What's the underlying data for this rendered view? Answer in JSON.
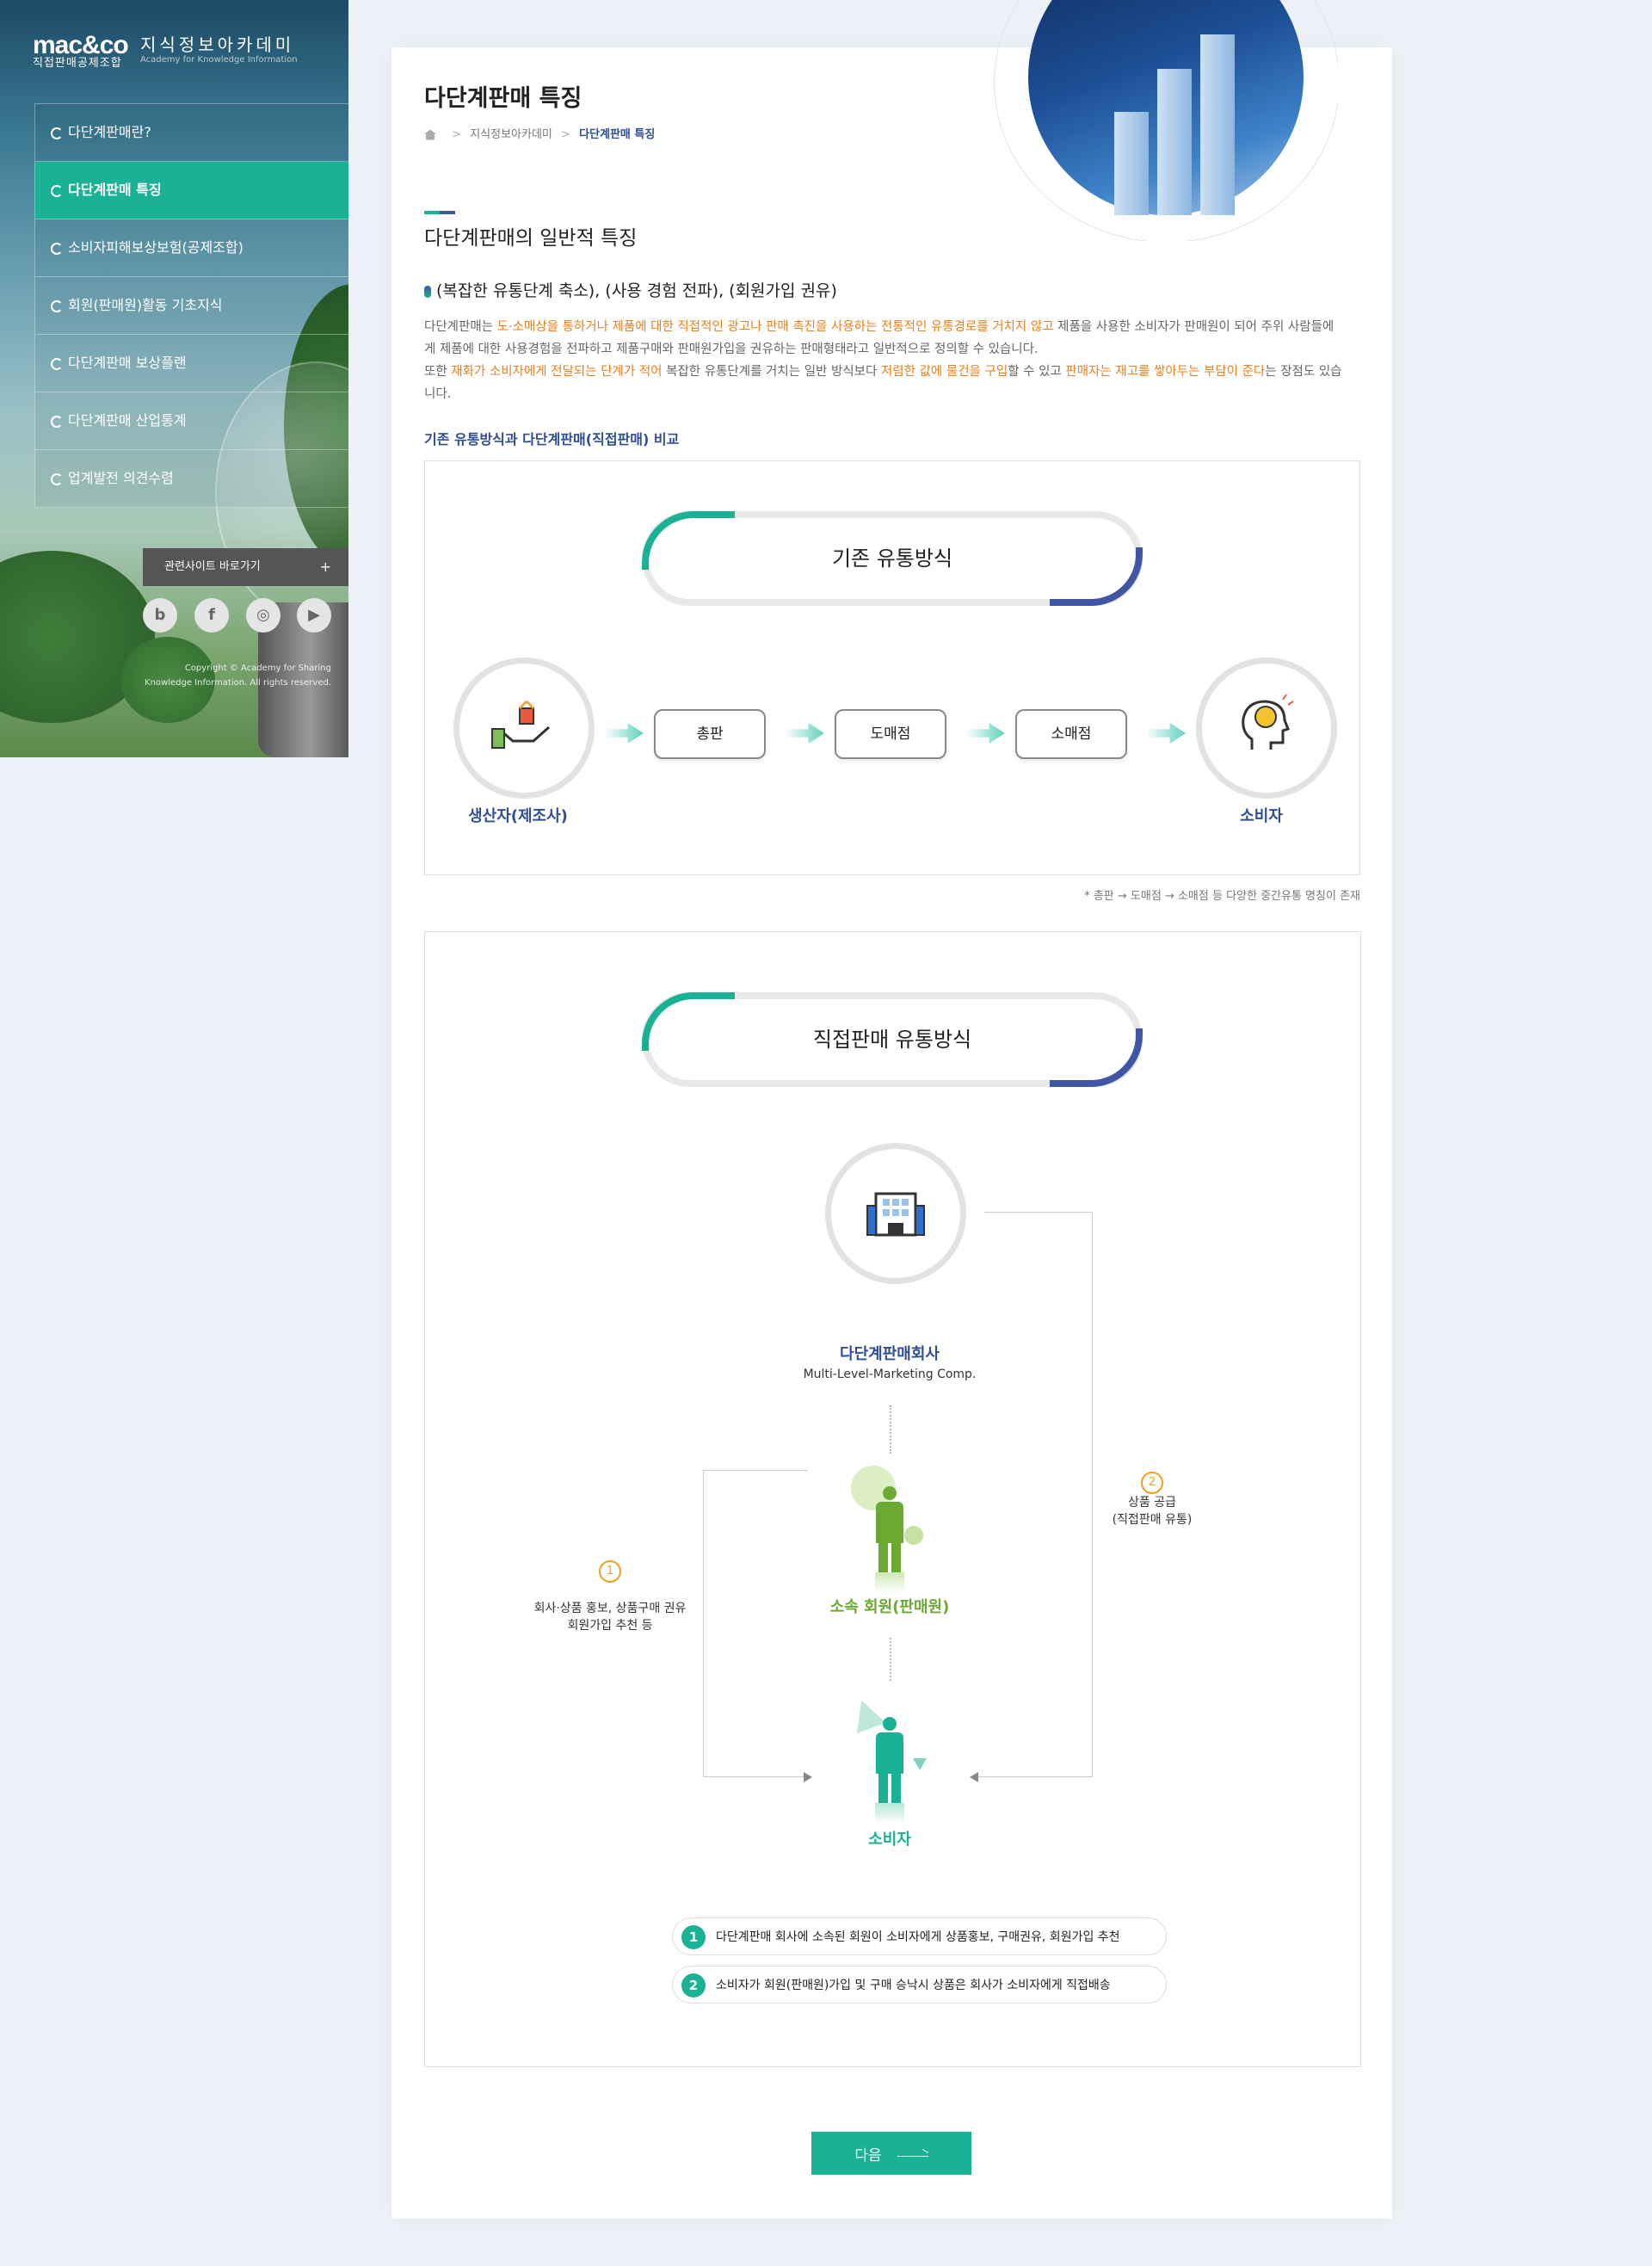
{
  "sidebar": {
    "logo_mark": "mac&co",
    "logo_sub": "직접판매공제조합",
    "logo_title": "지식정보아카데미",
    "logo_en": "Academy for Knowledge Information",
    "nav": [
      {
        "label": "다단계판매란?",
        "active": false
      },
      {
        "label": "다단계판매 특징",
        "active": true
      },
      {
        "label": "소비자피해보상보험(공제조합)",
        "active": false
      },
      {
        "label": "회원(판매원)활동 기초지식",
        "active": false
      },
      {
        "label": "다단계판매 보상플랜",
        "active": false
      },
      {
        "label": "다단계판매 산업통계",
        "active": false
      },
      {
        "label": "업계발전 의견수렴",
        "active": false
      }
    ],
    "related_label": "관련사이트 바로가기",
    "related_plus": "+",
    "sns": [
      {
        "icon": "blog-icon",
        "glyph": "b"
      },
      {
        "icon": "facebook-icon",
        "glyph": "f"
      },
      {
        "icon": "instagram-icon",
        "glyph": "◎"
      },
      {
        "icon": "youtube-icon",
        "glyph": "▶"
      }
    ],
    "copyright_1": "Copyright © Academy for Sharing",
    "copyright_2": "Knowledge Information. All rights reserved."
  },
  "header": {
    "title": "다단계판매 특징",
    "breadcrumb": [
      "지식정보아카데미",
      "다단계판매 특징"
    ]
  },
  "section": {
    "title": "다단계판매의 일반적 특징",
    "features": "(복잡한 유통단계 축소), (사용 경험 전파), (회원가입 권유)",
    "desc": {
      "p1_a": "다단계판매는 ",
      "p1_hl": "도·소매상을 통하거나 제품에 대한 직접적인 광고나 판매 촉진을 사용하는 전통적인 유통경로를 거치지 않고",
      "p1_b": " 제품을 사용한 소비자가 판매원이 되어 주위 사람들에게 제품에 대한 사용경험을 전파하고 제품구매와 판매원가입을 권유하는 판매형태라고 일반적으로 정의할 수 있습니다.",
      "p2_a": "또한 ",
      "p2_hl1": "재화가 소비자에게 전달되는 단계가 적어",
      "p2_b": " 복잡한 유통단계를 거치는 일반 방식보다 ",
      "p2_hl2": "저렴한 값에 물건을 구입",
      "p2_c": "할 수 있고 ",
      "p2_hl3": "판매자는 재고를 쌓아두는 부담이 준다",
      "p2_d": "는 장점도 있습니다."
    },
    "compare_title": "기존 유통방식과 다단계판매(직접판매) 비교"
  },
  "traditional": {
    "title": "기존 유통방식",
    "producer": "생산자(제조사)",
    "stages": [
      "총판",
      "도매점",
      "소매점"
    ],
    "consumer": "소비자",
    "note": "* 총판 → 도매점 → 소매점 등 다양한 중간유통 명칭이 존재"
  },
  "direct": {
    "title": "직접판매 유통방식",
    "company": "다단계판매회사",
    "company_en": "Multi-Level-Marketing Comp.",
    "member": "소속 회원(판매원)",
    "consumer": "소비자",
    "step1_num": "1",
    "step1_cap_1": "회사·상품 홍보, 상품구매 권유",
    "step1_cap_2": "회원가입 추천 등",
    "step2_num": "2",
    "step2_cap_1": "상품 공급",
    "step2_cap_2": "(직접판매 유통)",
    "legend": [
      {
        "num": "1",
        "text": "다단계판매 회사에 소속된 회원이 소비자에게 상품홍보, 구매권유, 회원가입 추천"
      },
      {
        "num": "2",
        "text": "소비자가 회원(판매원)가입 및 구매 승낙시 상품은 회사가 소비자에게 직접배송"
      }
    ]
  },
  "next_label": "다음",
  "colors": {
    "accent": "#19b294",
    "navy": "#2f4e94",
    "orange": "#ef7f1a",
    "green": "#6aaa33"
  }
}
